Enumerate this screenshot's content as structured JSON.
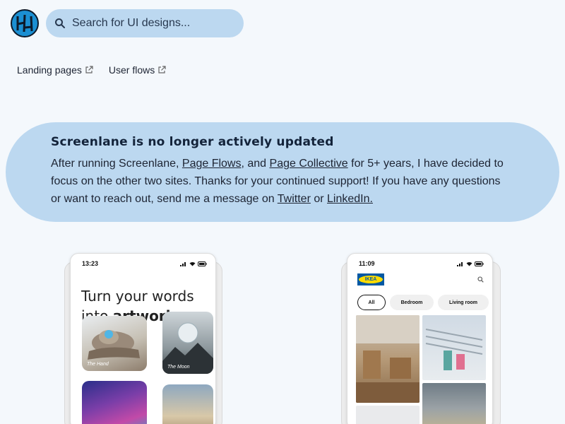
{
  "header": {
    "search_placeholder": "Search for UI designs...",
    "nav": [
      {
        "label": "Landing pages"
      },
      {
        "label": "User flows"
      }
    ]
  },
  "banner": {
    "title": "Screenlane is no longer actively updated",
    "text_1": "After running Screenlane, ",
    "link_page_flows": "Page Flows",
    "text_2": ", and ",
    "link_page_collective": "Page Collective",
    "text_3": " for 5+ years, I have decided to focus on the other two sites. Thanks for your continued support! If you have any questions or want to reach out, send me a message on ",
    "link_twitter": "Twitter",
    "text_4": " or ",
    "link_linkedin": "LinkedIn."
  },
  "cards": [
    {
      "time": "13:23",
      "headline_1": "Turn your words",
      "headline_2a": "into ",
      "headline_2b": "artwork",
      "tile_1_label": "The Hand",
      "tile_2_label": "The Moon"
    },
    {
      "time": "11:09",
      "brand": "IKEA",
      "chips": [
        "All",
        "Bedroom",
        "Living room"
      ]
    }
  ],
  "colors": {
    "background": "#f4f8fc",
    "accent": "#bcd8f0",
    "text": "#1d2433"
  }
}
